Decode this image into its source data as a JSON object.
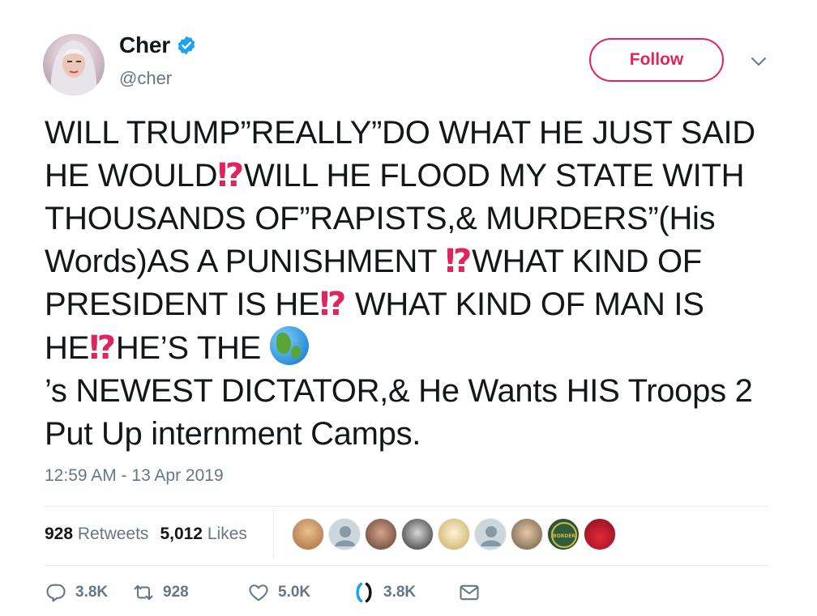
{
  "user": {
    "display_name": "Cher",
    "handle": "@cher",
    "verified": true
  },
  "follow_label": "Follow",
  "tweet": {
    "segments": [
      "WILL TRUMP”REALLY”DO WHAT HE JUST SAID HE WOULD",
      "⁉",
      "WILL HE FLOOD MY STATE WITH THOUSANDS OF”RAPISTS,& MURDERS”(His Words)AS A PUNISHMENT ",
      "⁉",
      "WHAT KIND OF PRESIDENT IS HE",
      "⁉",
      " WHAT KIND OF MAN IS HE",
      "⁉",
      "HE’S THE ",
      "’s NEWEST DICTATOR,& He Wants HIS Troops 2 Put Up internment Camps."
    ]
  },
  "timestamp": "12:59 AM - 13 Apr 2019",
  "stats": {
    "retweets_count": "928",
    "retweets_label": "Retweets",
    "likes_count": "5,012",
    "likes_label": "Likes"
  },
  "facepile": {
    "count": 10,
    "badge_text": "U.S. BORDER PATROL"
  },
  "actions": {
    "reply": "3.8K",
    "retweet": "928",
    "like": "5.0K",
    "dm": "3.8K"
  },
  "colors": {
    "accent": "#e0245e",
    "verified": "#1da1f2",
    "muted": "#657786",
    "divider": "#e6ecf0"
  },
  "icons": [
    "verified-badge-icon",
    "chevron-down-icon",
    "reply-icon",
    "retweet-icon",
    "like-icon",
    "dm-icon",
    "globe-emoji-icon"
  ]
}
